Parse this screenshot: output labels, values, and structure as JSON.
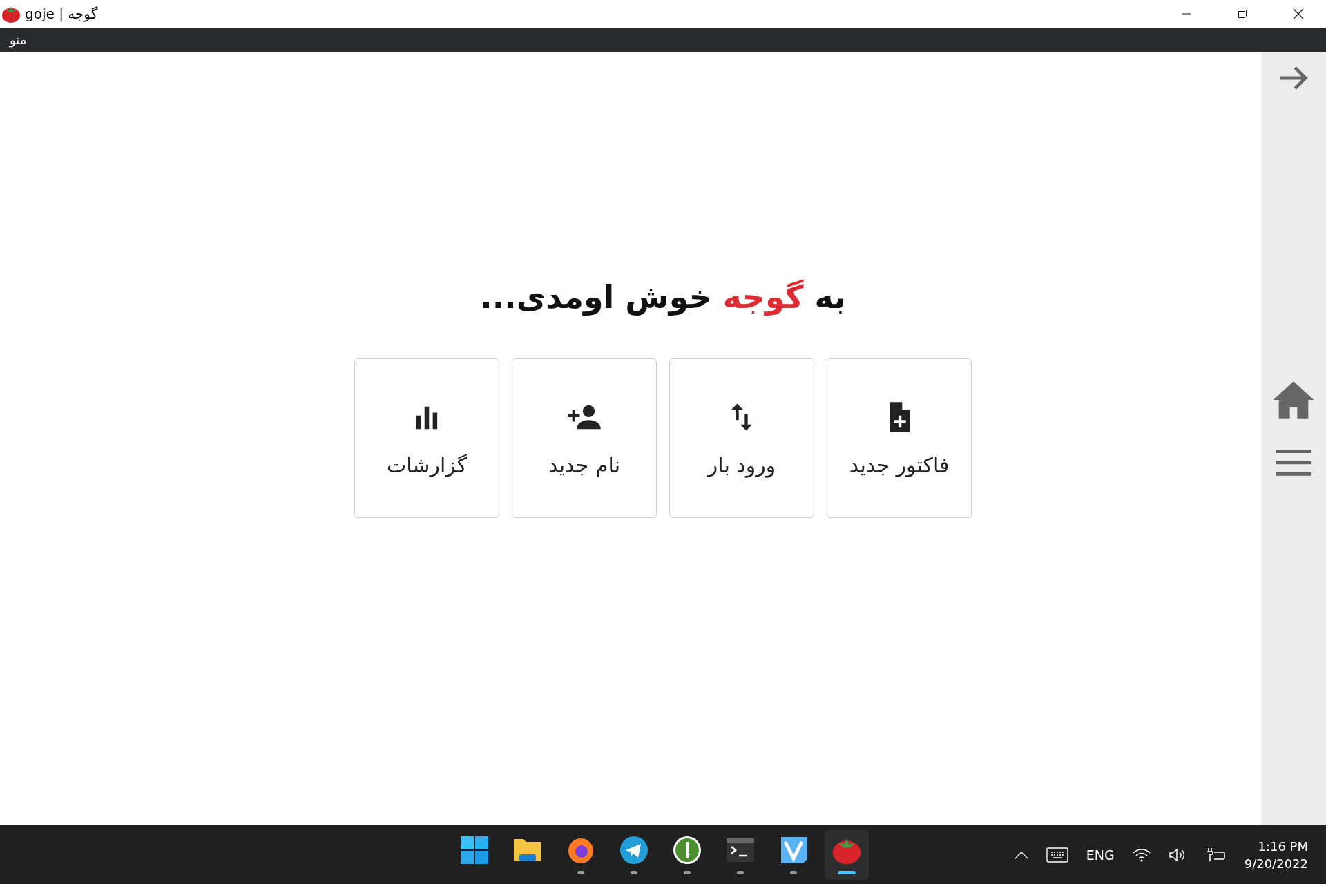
{
  "window": {
    "title": "goje | گوجه"
  },
  "menu_bar": {
    "label": "منو"
  },
  "heading": [
    {
      "text": "به ",
      "accent": false
    },
    {
      "text": "گوجه",
      "accent": true
    },
    {
      "text": " خوش اومدی...",
      "accent": false
    }
  ],
  "tiles": [
    {
      "label": "فاکتور جدید",
      "kind": "invoice"
    },
    {
      "label": "ورود بار",
      "kind": "transfer"
    },
    {
      "label": "نام جدید",
      "kind": "person"
    },
    {
      "label": "گزارشات",
      "kind": "reports"
    }
  ],
  "sidebar": {
    "items": [
      {
        "kind": "forward"
      },
      {
        "kind": "home"
      },
      {
        "kind": "menu"
      }
    ]
  },
  "taskbar": {
    "apps": [
      {
        "kind": "start",
        "running": false,
        "selected": false
      },
      {
        "kind": "folder",
        "running": false,
        "selected": false
      },
      {
        "kind": "firefox",
        "running": true,
        "selected": false
      },
      {
        "kind": "telegram",
        "running": true,
        "selected": false
      },
      {
        "kind": "key",
        "running": true,
        "selected": false
      },
      {
        "kind": "terminal",
        "running": true,
        "selected": false
      },
      {
        "kind": "v",
        "running": true,
        "selected": false
      },
      {
        "kind": "tomato",
        "running": true,
        "selected": true
      }
    ],
    "language": "ENG",
    "time": "1:16 PM",
    "date": "9/20/2022"
  }
}
